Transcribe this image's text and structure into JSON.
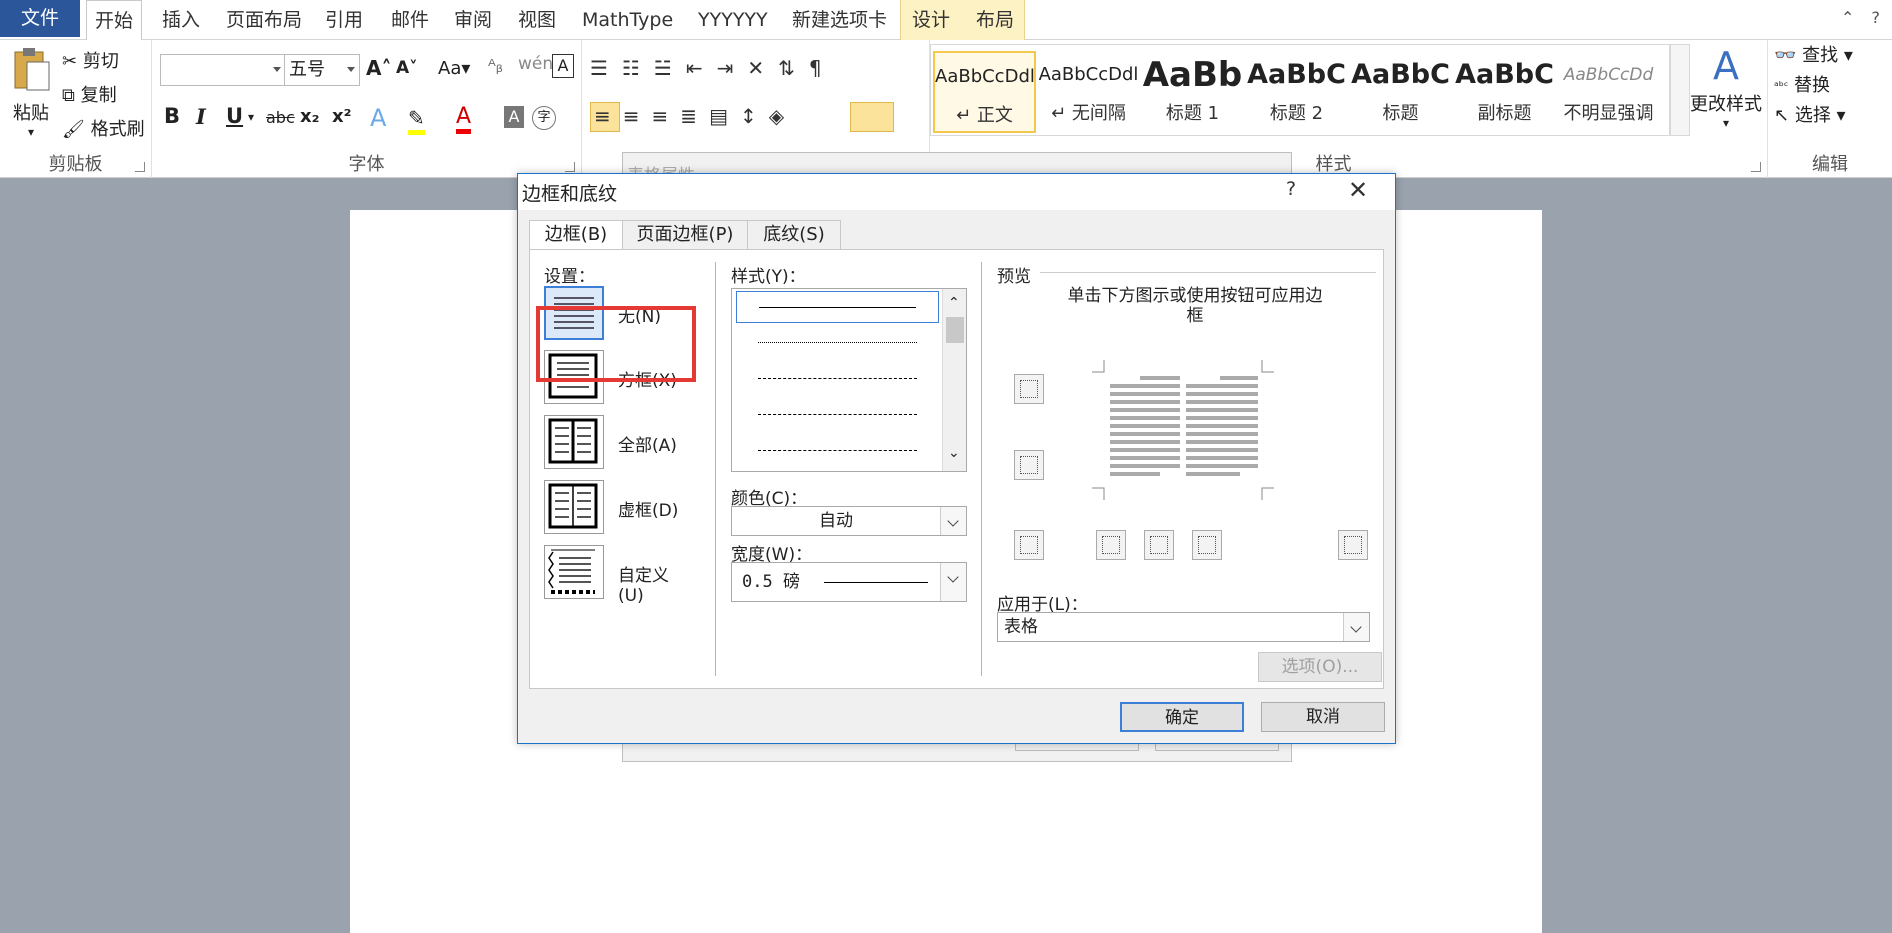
{
  "tabs": [
    "文件",
    "开始",
    "插入",
    "页面布局",
    "引用",
    "邮件",
    "审阅",
    "视图",
    "MathType",
    "YYYYYY",
    "新建选项卡",
    "设计",
    "布局"
  ],
  "ribbon": {
    "clipboard": {
      "label": "剪贴板",
      "paste": "粘贴",
      "cut": "剪切",
      "copy": "复制",
      "format_painter": "格式刷"
    },
    "font": {
      "label": "字体",
      "font_name": "",
      "font_size": "五号",
      "bold": "B",
      "italic": "I",
      "underline": "U",
      "strike": "abc",
      "sub": "x₂",
      "sup": "x²",
      "aa": "Aa",
      "grow": "A",
      "shrink": "A"
    },
    "paragraph": {
      "label": ""
    },
    "styles": {
      "label": "样式",
      "items": [
        {
          "sample": "AaBbCcDdl",
          "name": "↵ 正文"
        },
        {
          "sample": "AaBbCcDdl",
          "name": "↵ 无间隔"
        },
        {
          "sample": "AaBb",
          "name": "标题 1"
        },
        {
          "sample": "AaBbC",
          "name": "标题 2"
        },
        {
          "sample": "AaBbC",
          "name": "标题"
        },
        {
          "sample": "AaBbC",
          "name": "副标题"
        },
        {
          "sample": "AaBbCcDd",
          "name": "不明显强调"
        }
      ],
      "change_styles": "更改样式"
    },
    "editing": {
      "label": "编辑",
      "find": "查找",
      "replace": "替换",
      "select": "选择"
    }
  },
  "ghost_dialog": {
    "title": "表格属性"
  },
  "dialog": {
    "title": "边框和底纹",
    "help": "?",
    "close": "✕",
    "tabs": [
      "边框(B)",
      "页面边框(P)",
      "底纹(S)"
    ],
    "settings_label": "设置：",
    "settings": [
      "无(N)",
      "方框(X)",
      "全部(A)",
      "虚框(D)",
      "自定义(U)"
    ],
    "style_label": "样式(Y)：",
    "color_label": "颜色(C)：",
    "color_value": "自动",
    "width_label": "宽度(W)：",
    "width_value": "0.5 磅",
    "preview_label": "预览",
    "preview_hint": "单击下方图示或使用按钮可应用边框",
    "apply_label": "应用于(L)：",
    "apply_value": "表格",
    "options_button": "选项(O)...",
    "ok_button": "确定",
    "cancel_button": "取消"
  },
  "colors": {
    "accent": "#2b579a",
    "highlight": "#e53935",
    "selection": "#3b7fd6"
  }
}
